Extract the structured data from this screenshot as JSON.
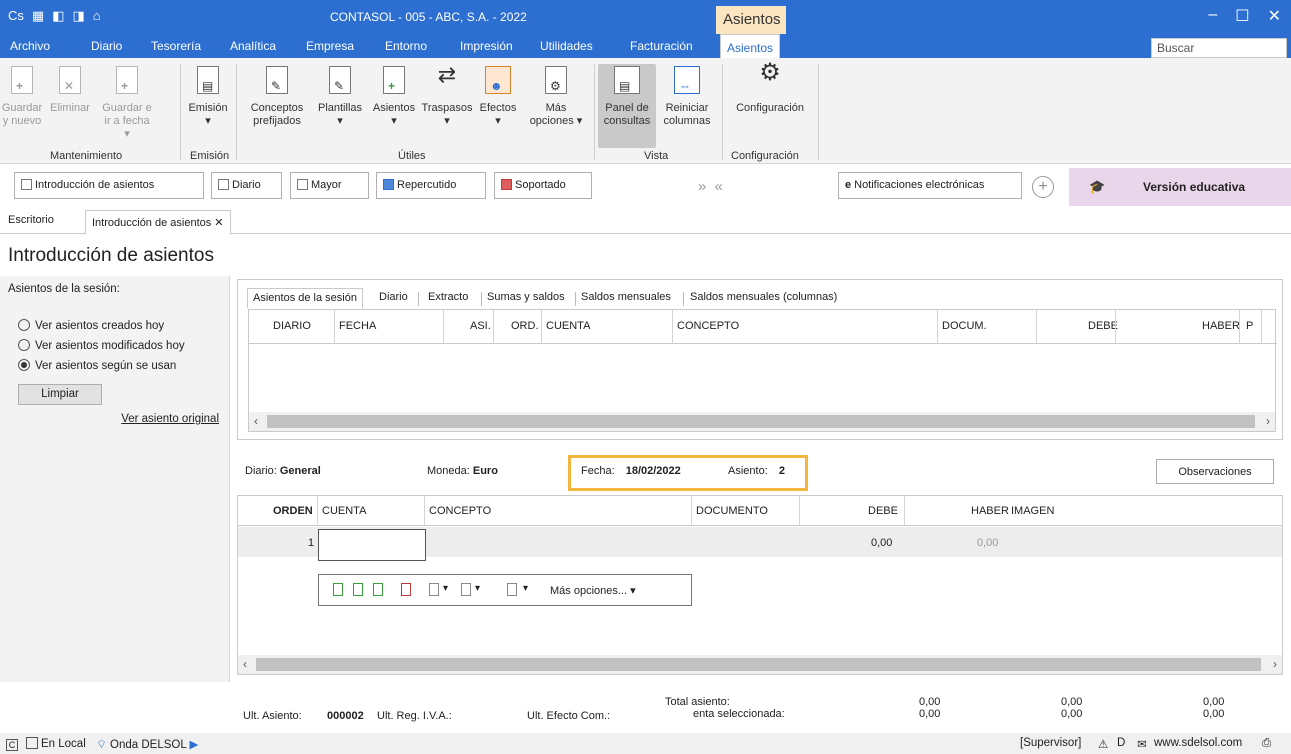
{
  "window": {
    "title": "CONTASOL - 005 - ABC, S.A. - 2022",
    "context_tab": "Asientos",
    "minimize": "–",
    "maximize": "☐",
    "close": "✕"
  },
  "menu": [
    "Archivo",
    "Diario",
    "Tesorería",
    "Analítica",
    "Empresa",
    "Entorno",
    "Impresión",
    "Utilidades",
    "Facturación",
    "Asientos"
  ],
  "search": {
    "placeholder": "Buscar"
  },
  "ribbon": {
    "guardar_nuevo": [
      "Guardar",
      "y nuevo"
    ],
    "eliminar": [
      "Eliminar",
      ""
    ],
    "guardar_fecha": [
      "Guardar e",
      "ir a fecha"
    ],
    "emision": [
      "Emisión",
      ""
    ],
    "conceptos": [
      "Conceptos",
      "prefijados"
    ],
    "plantillas": [
      "Plantillas",
      ""
    ],
    "asientos": [
      "Asientos",
      ""
    ],
    "traspasos": [
      "Traspasos",
      ""
    ],
    "efectos": [
      "Efectos",
      ""
    ],
    "mas_opciones": [
      "Más",
      "opciones"
    ],
    "panel_consultas": [
      "Panel de",
      "consultas"
    ],
    "reiniciar_columnas": [
      "Reiniciar",
      "columnas"
    ],
    "configuracion": [
      "Configuración",
      ""
    ],
    "groups": [
      "Mantenimiento",
      "Emisión",
      "Útiles",
      "Vista",
      "Configuración"
    ]
  },
  "toolbar": {
    "introduccion": "Introducción de asientos",
    "diario": "Diario",
    "mayor": "Mayor",
    "repercutido": "Repercutido",
    "soportado": "Soportado",
    "arrows": "» «",
    "notificaciones": "Notificaciones electrónicas",
    "version": "Versión educativa"
  },
  "doc_tabs": [
    "Escritorio",
    "Introducción de asientos ✕"
  ],
  "page_title": "Introducción de asientos",
  "left_panel": {
    "title": "Asientos de la sesión:",
    "options": [
      "Ver asientos creados hoy",
      "Ver asientos modificados hoy",
      "Ver asientos según se usan"
    ],
    "selected_index": 2,
    "button": "Limpiar",
    "link": "Ver asiento original"
  },
  "grid_tabs": [
    "Asientos de la sesión",
    "Diario",
    "Extracto",
    "Sumas y saldos",
    "Saldos mensuales",
    "Saldos mensuales (columnas)"
  ],
  "grid1_columns": [
    "DIARIO",
    "FECHA",
    "ASI.",
    "ORD.",
    "CUENTA",
    "CONCEPTO",
    "DOCUM.",
    "DEBE",
    "HABER",
    "P"
  ],
  "entry": {
    "diario_label": "Diario:",
    "diario_value": "General",
    "moneda_label": "Moneda:",
    "moneda_value": "Euro",
    "fecha_label": "Fecha:",
    "fecha_value": "18/02/2022",
    "asiento_label": "Asiento:",
    "asiento_value": "2",
    "observaciones": "Observaciones"
  },
  "grid2_columns": [
    "ORDEN",
    "CUENTA",
    "CONCEPTO",
    "DOCUMENTO",
    "DEBE",
    "HABER",
    "IMAGEN"
  ],
  "grid2_row": {
    "orden": "1",
    "debe": "0,00",
    "haber": "0,00"
  },
  "mini_toolbar": {
    "mas_opciones": "Más opciones..."
  },
  "totals": {
    "ult_asiento_label": "Ult. Asiento:",
    "ult_asiento_value": "000002",
    "ult_reg_iva": "Ult. Reg. I.V.A.:",
    "ult_efecto": "Ult. Efecto Com.:",
    "total_asiento": "Total asiento:",
    "cuenta_sel": "enta seleccionada:",
    "col1": [
      "0,00",
      "0,00"
    ],
    "col2": [
      "0,00",
      "0,00"
    ],
    "col3": [
      "0,00",
      "0,00"
    ]
  },
  "status": {
    "en_local": "En Local",
    "onda": "Onda DELSOL",
    "supervisor": "[Supervisor]",
    "website": "www.sdelsol.com"
  },
  "colors": {
    "title_blue": "#2c6fd1",
    "highlight": "#f4b63f",
    "edu_bg": "#ead6ea"
  }
}
